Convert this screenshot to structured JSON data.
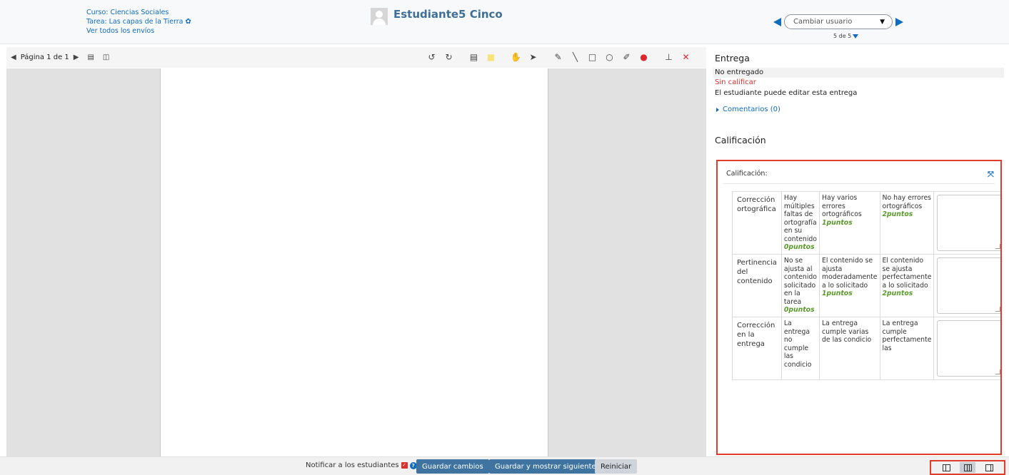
{
  "header": {
    "course_link": "Curso: Ciencias Sociales",
    "assignment_link": "Tarea: Las capas de la Tierra",
    "view_all_link": "Ver todos los envíos",
    "student_name": "Estudiante5 Cinco",
    "change_user_placeholder": "Cambiar usuario",
    "user_count": "5 de 5"
  },
  "toolbar": {
    "page_label": "Página 1 de 1"
  },
  "submission": {
    "heading": "Entrega",
    "status": "No entregado",
    "grade_status": "Sin calificar",
    "edit_note": "El estudiante puede editar esta entrega",
    "comments_link": "Comentarios (0)"
  },
  "grading": {
    "heading": "Calificación",
    "caption": "Calificación:",
    "criteria": [
      {
        "name": "Corrección ortográfica",
        "levels": [
          {
            "text": "Hay múltiples faltas de ortografía en su contenido",
            "points": "0puntos"
          },
          {
            "text": "Hay varios errores ortográficos",
            "points": "1puntos"
          },
          {
            "text": "No hay errores ortográficos",
            "points": "2puntos"
          }
        ]
      },
      {
        "name": "Pertinencia del contenido",
        "levels": [
          {
            "text": "No se ajusta al contenido solicitado en la tarea",
            "points": "0puntos"
          },
          {
            "text": "El contenido se ajusta moderadamente a lo solicitado",
            "points": "1puntos"
          },
          {
            "text": "El contenido se ajusta perfectamente a lo solicitado",
            "points": "2puntos"
          }
        ]
      },
      {
        "name": "Corrección en la entrega",
        "levels": [
          {
            "text": "La entrega no cumple las condicio",
            "points": ""
          },
          {
            "text": "La entrega cumple varias de las condicio",
            "points": ""
          },
          {
            "text": "La entrega cumple perfectamente las",
            "points": ""
          }
        ]
      }
    ]
  },
  "footer": {
    "notify_label": "Notificar a los estudiantes",
    "save_label": "Guardar cambios",
    "save_next_label": "Guardar y mostrar siguiente",
    "reset_label": "Reiniciar"
  },
  "colors": {
    "accent": "#0f6cbf",
    "primary_button": "#3f74a1",
    "highlight_border": "#e03c2a",
    "points_green": "#5a9a2a",
    "not_graded_red": "#d9302d"
  }
}
